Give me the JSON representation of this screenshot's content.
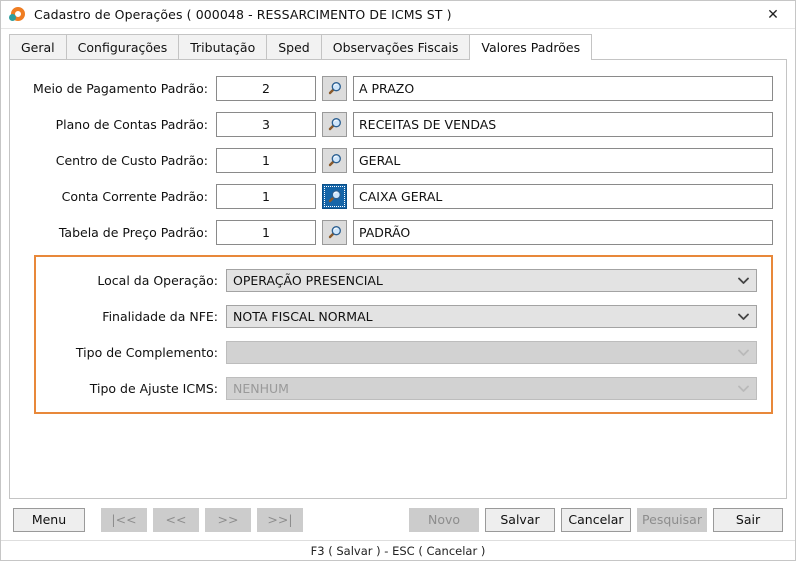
{
  "window": {
    "title": "Cadastro de Operações ( 000048 - RESSARCIMENTO DE ICMS ST )",
    "close_label": "✕",
    "logo_icon": "app-logo-icon",
    "accent_orange": "#e8883a",
    "focus_blue": "#1565a8"
  },
  "tabs": [
    {
      "label": "Geral",
      "active": false
    },
    {
      "label": "Configurações",
      "active": false
    },
    {
      "label": "Tributação",
      "active": false
    },
    {
      "label": "Sped",
      "active": false
    },
    {
      "label": "Observações Fiscais",
      "active": false
    },
    {
      "label": "Valores Padrões",
      "active": true
    }
  ],
  "lookup_rows": [
    {
      "label": "Meio de Pagamento Padrão:",
      "code": "2",
      "description": "A PRAZO",
      "lookup_icon": "magnifier-icon",
      "focused": false
    },
    {
      "label": "Plano de Contas Padrão:",
      "code": "3",
      "description": "RECEITAS DE VENDAS",
      "lookup_icon": "magnifier-icon",
      "focused": false
    },
    {
      "label": "Centro de Custo Padrão:",
      "code": "1",
      "description": "GERAL",
      "lookup_icon": "magnifier-icon",
      "focused": false
    },
    {
      "label": "Conta Corrente Padrão:",
      "code": "1",
      "description": "CAIXA GERAL",
      "lookup_icon": "magnifier-icon",
      "focused": true
    },
    {
      "label": "Tabela de Preço Padrão:",
      "code": "1",
      "description": "PADRÃO",
      "lookup_icon": "magnifier-icon",
      "focused": false
    }
  ],
  "dropdown_rows": [
    {
      "label": "Local da Operação:",
      "value": "OPERAÇÃO PRESENCIAL",
      "disabled": false,
      "arrow_icon": "chevron-down-icon"
    },
    {
      "label": "Finalidade da NFE:",
      "value": "NOTA FISCAL NORMAL",
      "disabled": false,
      "arrow_icon": "chevron-down-icon"
    },
    {
      "label": "Tipo de Complemento:",
      "value": "",
      "disabled": true,
      "arrow_icon": "chevron-down-icon"
    },
    {
      "label": "Tipo de Ajuste ICMS:",
      "value": "NENHUM",
      "disabled": true,
      "arrow_icon": "chevron-down-icon"
    }
  ],
  "buttons": {
    "menu": {
      "label": "Menu",
      "disabled": false
    },
    "first": {
      "label": "|<<",
      "disabled": true
    },
    "previous": {
      "label": "<<",
      "disabled": true
    },
    "next": {
      "label": ">>",
      "disabled": true
    },
    "last": {
      "label": ">>|",
      "disabled": true
    },
    "novo": {
      "label": "Novo",
      "disabled": true
    },
    "salvar": {
      "label": "Salvar",
      "disabled": false
    },
    "cancelar": {
      "label": "Cancelar",
      "disabled": false
    },
    "pesquisar": {
      "label": "Pesquisar",
      "disabled": true
    },
    "sair": {
      "label": "Sair",
      "disabled": false
    }
  },
  "statusbar": {
    "text": "F3 ( Salvar )  -  ESC ( Cancelar )"
  }
}
